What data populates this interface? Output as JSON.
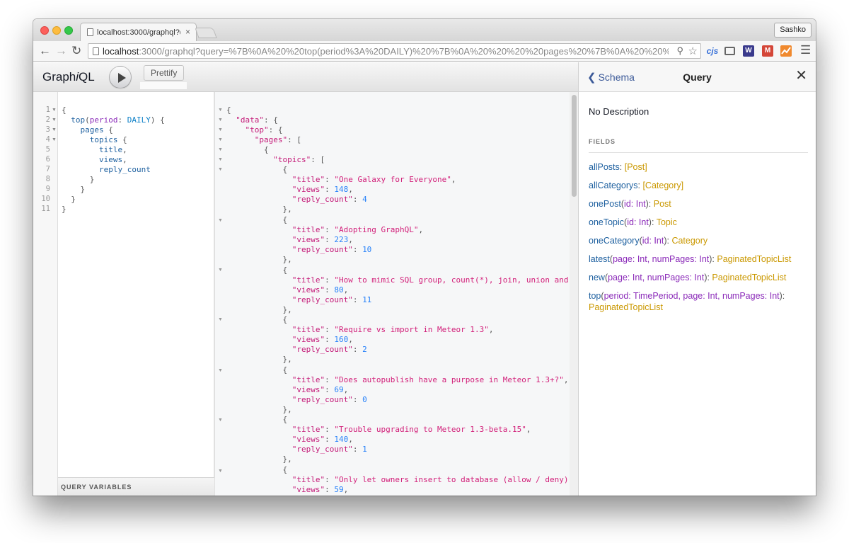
{
  "browser": {
    "tab_title": "localhost:3000/graphql?qu",
    "tab_close": "×",
    "profile": "Sashko",
    "url_host": "localhost",
    "url_rest": ":3000/graphql?query=%7B%0A%20%20top(period%3A%20DAILY)%20%7B%0A%20%20%20%20pages%20%7B%0A%20%20%20%20%20%2...",
    "ext_cjs": "cjs",
    "ext_w": "W",
    "ext_gm": "M",
    "icons": [
      "back-arrow-icon",
      "forward-arrow-icon",
      "reload-icon",
      "page-icon",
      "zoom-icon",
      "star-icon",
      "cast-icon",
      "hamburger-menu-icon"
    ]
  },
  "graphiql": {
    "logo_prefix": "Graph",
    "logo_i": "i",
    "logo_suffix": "QL",
    "prettify_label": "Prettify",
    "query_variables_label": "QUERY VARIABLES",
    "line_numbers": [
      "1",
      "2",
      "3",
      "4",
      "5",
      "6",
      "7",
      "8",
      "9",
      "10",
      "11"
    ]
  },
  "docs": {
    "back_label": "Schema",
    "title": "Query",
    "description": "No Description",
    "fields_heading": "FIELDS",
    "fields": [
      {
        "name": "allPosts",
        "type": "[Post]"
      },
      {
        "name": "allCategorys",
        "type": "[Category]"
      },
      {
        "name": "onePost",
        "args": "id: Int",
        "type": "Post"
      },
      {
        "name": "oneTopic",
        "args": "id: Int",
        "type": "Topic"
      },
      {
        "name": "oneCategory",
        "args": "id: Int",
        "type": "Category"
      },
      {
        "name": "latest",
        "args": "page: Int, numPages: Int",
        "type": "PaginatedTopicList"
      },
      {
        "name": "new",
        "args": "page: Int, numPages: Int",
        "type": "PaginatedTopicList"
      },
      {
        "name": "top",
        "args": "period: TimePeriod, page: Int, numPages: Int",
        "type": "PaginatedTopicList"
      }
    ]
  },
  "results": {
    "topics": [
      {
        "title": "\"One Galaxy for Everyone\"",
        "views": "148",
        "reply_count": "4"
      },
      {
        "title": "\"Adopting GraphQL\"",
        "views": "223",
        "reply_count": "10"
      },
      {
        "title": "\"How to mimic SQL group, count(*), join, union and",
        "views": "80",
        "reply_count": "11"
      },
      {
        "title": "\"Require vs import in Meteor 1.3\"",
        "views": "160",
        "reply_count": "2"
      },
      {
        "title": "\"Does autopublish have a purpose in Meteor 1.3+?\"",
        "views": "69",
        "reply_count": "0"
      },
      {
        "title": "\"Trouble upgrading to Meteor 1.3-beta.15\"",
        "views": "140",
        "reply_count": "1"
      },
      {
        "title": "\"Only let owners insert to database (allow / deny)\"",
        "views": "59"
      }
    ]
  }
}
